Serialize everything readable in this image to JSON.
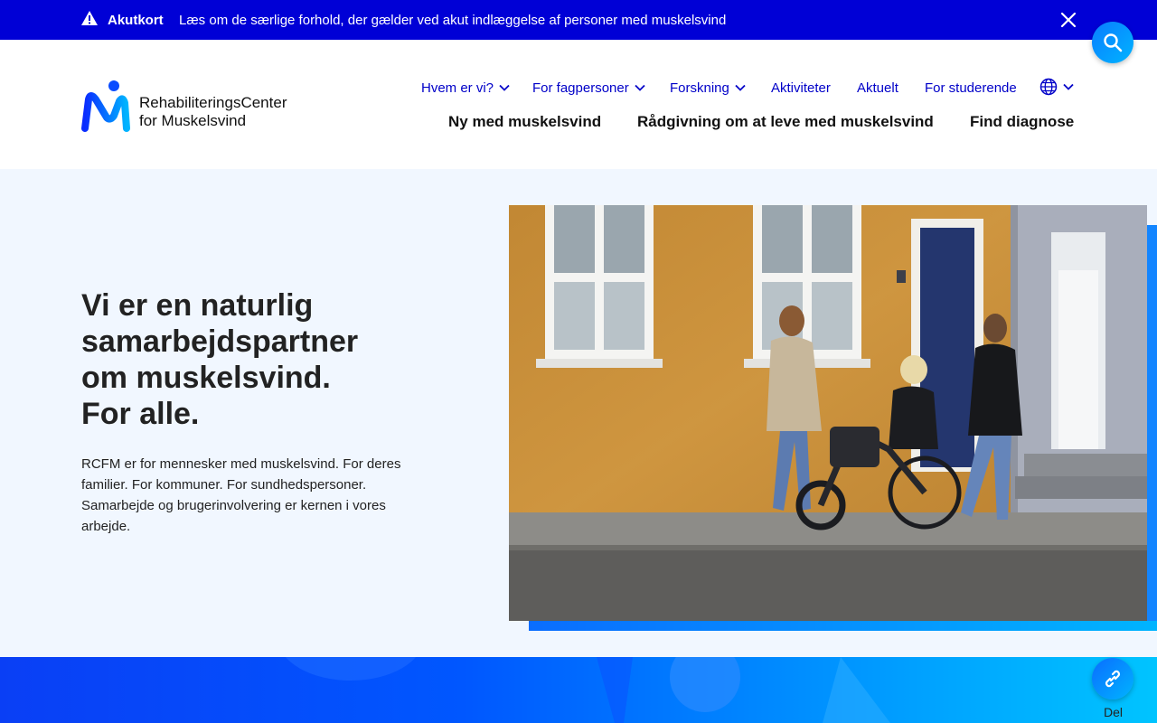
{
  "alert": {
    "title": "Akutkort",
    "text": "Læs om de særlige forhold, der gælder ved akut indlæggelse af personer med muskelsvind"
  },
  "logo": {
    "line1": "RehabiliteringsCenter",
    "line2": "for Muskelsvind"
  },
  "top_nav": [
    {
      "label": "Hvem er vi?",
      "dropdown": true
    },
    {
      "label": "For fagpersoner",
      "dropdown": true
    },
    {
      "label": "Forskning",
      "dropdown": true
    },
    {
      "label": "Aktiviteter",
      "dropdown": false
    },
    {
      "label": "Aktuelt",
      "dropdown": false
    },
    {
      "label": "For studerende",
      "dropdown": false
    }
  ],
  "main_nav": [
    {
      "label": "Ny med muskelsvind"
    },
    {
      "label": "Rådgivning om at leve med muskelsvind"
    },
    {
      "label": "Find diagnose"
    }
  ],
  "hero": {
    "title_lines": [
      "Vi er en naturlig",
      "samarbejdspartner",
      "om muskelsvind.",
      "For alle."
    ],
    "body": "RCFM er for mennesker med muskelsvind. For deres familier. For kommuner. For sundhedspersoner. Samarbejde og brugerinvolvering er kernen i vores arbejde."
  },
  "share": {
    "label": "Del"
  },
  "colors": {
    "alert_bg": "#0000d6",
    "nav_link": "#0000c8",
    "hero_bg": "#f1f7ff",
    "accent": "#1385ff",
    "wall": "#c98f3a"
  },
  "icons": {
    "alert": "warning-icon",
    "close": "close-icon",
    "search": "search-icon",
    "language": "globe-icon",
    "share": "link-icon"
  }
}
